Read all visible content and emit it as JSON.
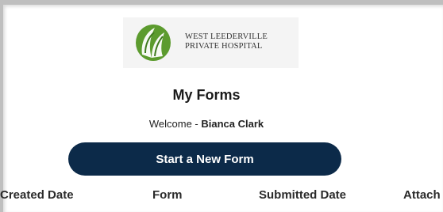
{
  "logo": {
    "line1": "WEST LEEDERVILLE",
    "line2": "PRIVATE HOSPITAL",
    "icon": "hospital-leaf-logo"
  },
  "page": {
    "title": "My Forms"
  },
  "welcome": {
    "prefix": "Welcome - ",
    "user_name": "Bianca Clark"
  },
  "actions": {
    "start_new_form": "Start a New Form"
  },
  "table": {
    "columns": [
      "Created Date",
      "Form",
      "Submitted Date",
      "Attach"
    ]
  },
  "colors": {
    "button_bg": "#0c2a49",
    "logo_green": "#5a9a2c"
  }
}
